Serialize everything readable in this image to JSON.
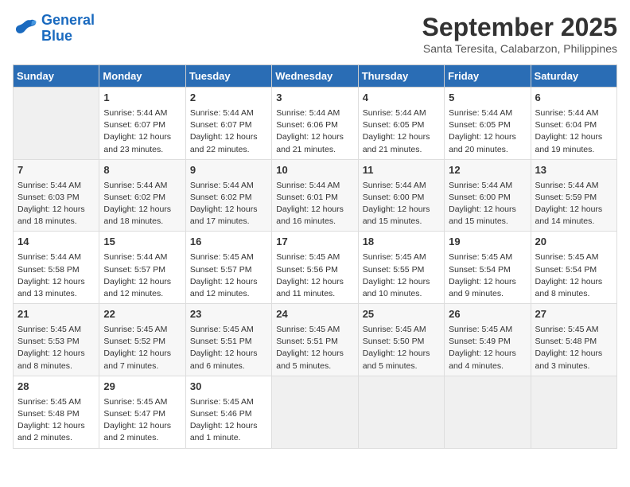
{
  "header": {
    "logo_line1": "General",
    "logo_line2": "Blue",
    "month": "September 2025",
    "location": "Santa Teresita, Calabarzon, Philippines"
  },
  "days_of_week": [
    "Sunday",
    "Monday",
    "Tuesday",
    "Wednesday",
    "Thursday",
    "Friday",
    "Saturday"
  ],
  "weeks": [
    [
      {
        "day": "",
        "content": ""
      },
      {
        "day": "1",
        "content": "Sunrise: 5:44 AM\nSunset: 6:07 PM\nDaylight: 12 hours\nand 23 minutes."
      },
      {
        "day": "2",
        "content": "Sunrise: 5:44 AM\nSunset: 6:07 PM\nDaylight: 12 hours\nand 22 minutes."
      },
      {
        "day": "3",
        "content": "Sunrise: 5:44 AM\nSunset: 6:06 PM\nDaylight: 12 hours\nand 21 minutes."
      },
      {
        "day": "4",
        "content": "Sunrise: 5:44 AM\nSunset: 6:05 PM\nDaylight: 12 hours\nand 21 minutes."
      },
      {
        "day": "5",
        "content": "Sunrise: 5:44 AM\nSunset: 6:05 PM\nDaylight: 12 hours\nand 20 minutes."
      },
      {
        "day": "6",
        "content": "Sunrise: 5:44 AM\nSunset: 6:04 PM\nDaylight: 12 hours\nand 19 minutes."
      }
    ],
    [
      {
        "day": "7",
        "content": "Sunrise: 5:44 AM\nSunset: 6:03 PM\nDaylight: 12 hours\nand 18 minutes."
      },
      {
        "day": "8",
        "content": "Sunrise: 5:44 AM\nSunset: 6:02 PM\nDaylight: 12 hours\nand 18 minutes."
      },
      {
        "day": "9",
        "content": "Sunrise: 5:44 AM\nSunset: 6:02 PM\nDaylight: 12 hours\nand 17 minutes."
      },
      {
        "day": "10",
        "content": "Sunrise: 5:44 AM\nSunset: 6:01 PM\nDaylight: 12 hours\nand 16 minutes."
      },
      {
        "day": "11",
        "content": "Sunrise: 5:44 AM\nSunset: 6:00 PM\nDaylight: 12 hours\nand 15 minutes."
      },
      {
        "day": "12",
        "content": "Sunrise: 5:44 AM\nSunset: 6:00 PM\nDaylight: 12 hours\nand 15 minutes."
      },
      {
        "day": "13",
        "content": "Sunrise: 5:44 AM\nSunset: 5:59 PM\nDaylight: 12 hours\nand 14 minutes."
      }
    ],
    [
      {
        "day": "14",
        "content": "Sunrise: 5:44 AM\nSunset: 5:58 PM\nDaylight: 12 hours\nand 13 minutes."
      },
      {
        "day": "15",
        "content": "Sunrise: 5:44 AM\nSunset: 5:57 PM\nDaylight: 12 hours\nand 12 minutes."
      },
      {
        "day": "16",
        "content": "Sunrise: 5:45 AM\nSunset: 5:57 PM\nDaylight: 12 hours\nand 12 minutes."
      },
      {
        "day": "17",
        "content": "Sunrise: 5:45 AM\nSunset: 5:56 PM\nDaylight: 12 hours\nand 11 minutes."
      },
      {
        "day": "18",
        "content": "Sunrise: 5:45 AM\nSunset: 5:55 PM\nDaylight: 12 hours\nand 10 minutes."
      },
      {
        "day": "19",
        "content": "Sunrise: 5:45 AM\nSunset: 5:54 PM\nDaylight: 12 hours\nand 9 minutes."
      },
      {
        "day": "20",
        "content": "Sunrise: 5:45 AM\nSunset: 5:54 PM\nDaylight: 12 hours\nand 8 minutes."
      }
    ],
    [
      {
        "day": "21",
        "content": "Sunrise: 5:45 AM\nSunset: 5:53 PM\nDaylight: 12 hours\nand 8 minutes."
      },
      {
        "day": "22",
        "content": "Sunrise: 5:45 AM\nSunset: 5:52 PM\nDaylight: 12 hours\nand 7 minutes."
      },
      {
        "day": "23",
        "content": "Sunrise: 5:45 AM\nSunset: 5:51 PM\nDaylight: 12 hours\nand 6 minutes."
      },
      {
        "day": "24",
        "content": "Sunrise: 5:45 AM\nSunset: 5:51 PM\nDaylight: 12 hours\nand 5 minutes."
      },
      {
        "day": "25",
        "content": "Sunrise: 5:45 AM\nSunset: 5:50 PM\nDaylight: 12 hours\nand 5 minutes."
      },
      {
        "day": "26",
        "content": "Sunrise: 5:45 AM\nSunset: 5:49 PM\nDaylight: 12 hours\nand 4 minutes."
      },
      {
        "day": "27",
        "content": "Sunrise: 5:45 AM\nSunset: 5:48 PM\nDaylight: 12 hours\nand 3 minutes."
      }
    ],
    [
      {
        "day": "28",
        "content": "Sunrise: 5:45 AM\nSunset: 5:48 PM\nDaylight: 12 hours\nand 2 minutes."
      },
      {
        "day": "29",
        "content": "Sunrise: 5:45 AM\nSunset: 5:47 PM\nDaylight: 12 hours\nand 2 minutes."
      },
      {
        "day": "30",
        "content": "Sunrise: 5:45 AM\nSunset: 5:46 PM\nDaylight: 12 hours\nand 1 minute."
      },
      {
        "day": "",
        "content": ""
      },
      {
        "day": "",
        "content": ""
      },
      {
        "day": "",
        "content": ""
      },
      {
        "day": "",
        "content": ""
      }
    ]
  ]
}
